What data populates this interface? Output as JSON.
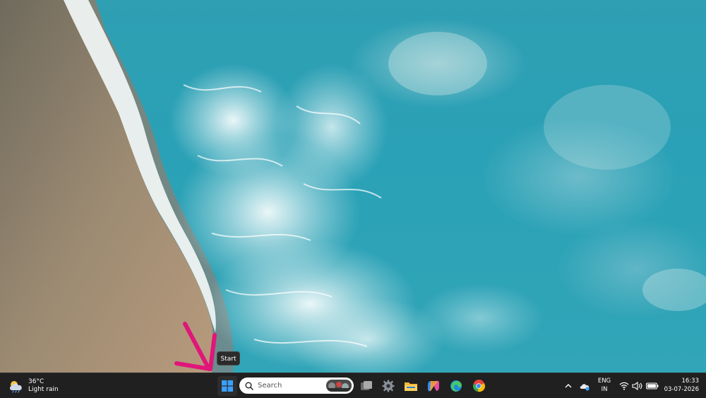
{
  "weather": {
    "temperature": "36°C",
    "condition": "Light rain",
    "icon": "cloud-rain-icon"
  },
  "tooltip": {
    "text": "Start"
  },
  "taskbar": {
    "start_icon": "windows-logo-icon",
    "search": {
      "placeholder": "Search",
      "icon": "search-icon"
    },
    "pinned": [
      {
        "name": "task-view",
        "icon": "task-view-icon"
      },
      {
        "name": "settings",
        "icon": "gear-icon"
      },
      {
        "name": "file-explorer",
        "icon": "folder-icon"
      },
      {
        "name": "copilot",
        "icon": "copilot-icon"
      },
      {
        "name": "edge",
        "icon": "edge-icon"
      },
      {
        "name": "chrome",
        "icon": "chrome-icon"
      }
    ]
  },
  "tray": {
    "language_line1": "ENG",
    "language_line2": "IN",
    "time": "16:33",
    "date": "03-07-2026"
  },
  "colors": {
    "taskbar_bg": "#202020",
    "annotation_arrow": "#e0167a",
    "accent": "#0078d4"
  }
}
